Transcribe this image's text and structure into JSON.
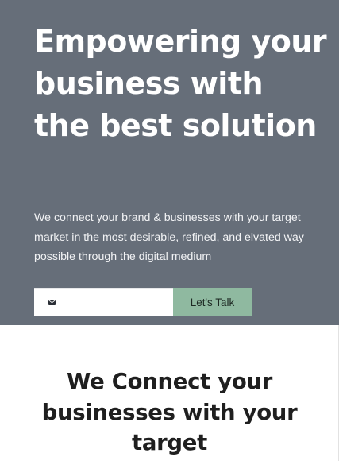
{
  "hero": {
    "title": "Empowering your business with the best solution",
    "subtitle": "We connect your brand & businesses with your target market in the most desirable, refined, and elvated way possible through the digital medium",
    "email_input": {
      "value": "",
      "placeholder": ""
    },
    "button_label": "Let's Talk",
    "envelope_icon": "envelope-icon"
  },
  "section": {
    "title": "We Connect your businesses with your target"
  },
  "colors": {
    "hero_background": "#666e79",
    "button_background": "#8fb9a0",
    "heading_text": "#1f1f1f"
  }
}
